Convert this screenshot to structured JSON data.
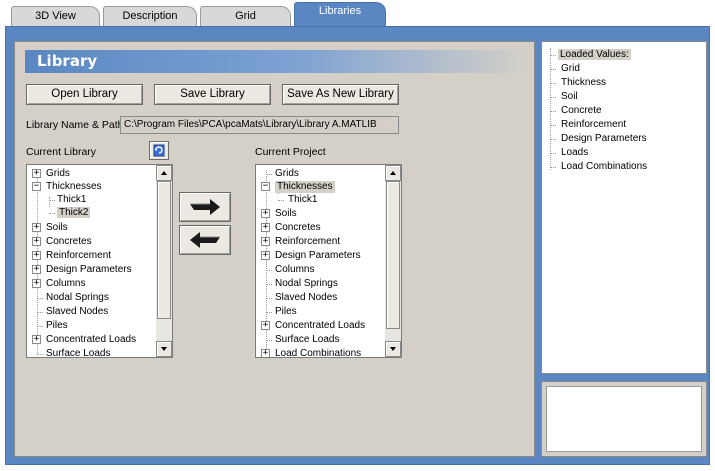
{
  "tabs": [
    {
      "label": "3D View"
    },
    {
      "label": "Description"
    },
    {
      "label": "Grid"
    },
    {
      "label": "Libraries",
      "active": true
    }
  ],
  "header": {
    "title": "Library"
  },
  "buttons": {
    "open": "Open Library",
    "save": "Save Library",
    "save_as": "Save As New Library"
  },
  "path": {
    "label": "Library Name & Path",
    "value": "C:\\Program Files\\PCA\\pcaMats\\Library\\Library A.MATLIB"
  },
  "current_library": {
    "label": "Current Library",
    "items": [
      "Grids",
      "Thicknesses",
      "Thick1",
      "Thick2",
      "Soils",
      "Concretes",
      "Reinforcement",
      "Design Parameters",
      "Columns",
      "Nodal Springs",
      "Slaved Nodes",
      "Piles",
      "Concentrated Loads",
      "Surface Loads"
    ],
    "selected": "Thick2"
  },
  "current_project": {
    "label": "Current Project",
    "items": [
      "Grids",
      "Thicknesses",
      "Thick1",
      "Soils",
      "Concretes",
      "Reinforcement",
      "Design Parameters",
      "Columns",
      "Nodal Springs",
      "Slaved Nodes",
      "Piles",
      "Concentrated Loads",
      "Surface Loads",
      "Load Combinations"
    ],
    "selected": "Thicknesses"
  },
  "loaded_values": {
    "root": "Loaded Values:",
    "items": [
      "Grid",
      "Thickness",
      "Soil",
      "Concrete",
      "Reinforcement",
      "Design Parameters",
      "Loads",
      "Load Combinations"
    ]
  },
  "colors": {
    "frame_blue": "#5a87c2",
    "panel_gray": "#d4d0c8",
    "selection_gray": "#d4d0c8"
  },
  "icons": [
    "refresh-icon",
    "arrow-right-icon",
    "arrow-left-icon",
    "expand-icon",
    "collapse-icon",
    "scroll-up-icon",
    "scroll-down-icon"
  ]
}
